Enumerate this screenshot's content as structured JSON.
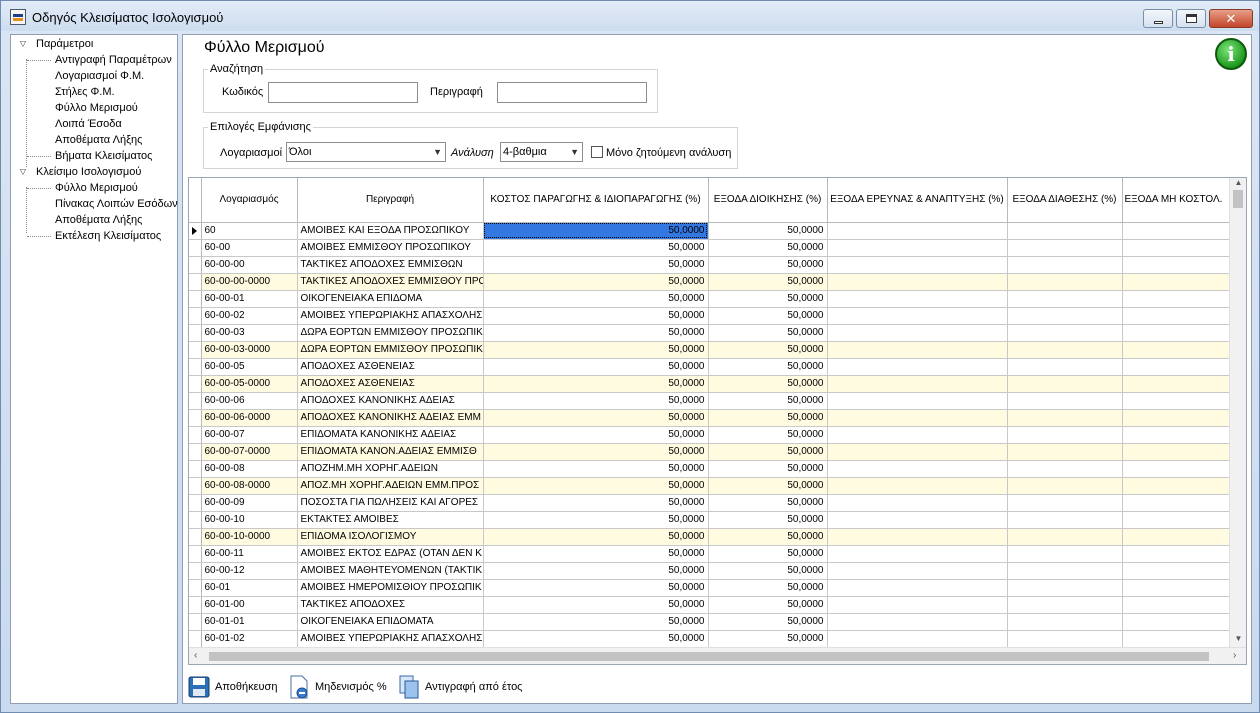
{
  "window": {
    "title": "Οδηγός Κλεισίματος Ισολογισμού"
  },
  "tree": {
    "groups": [
      {
        "label": "Παράμετροι",
        "items": [
          "Αντιγραφή Παραμέτρων",
          "Λογαριασμοί Φ.Μ.",
          "Στήλες Φ.Μ.",
          "Φύλλο Μερισμού",
          "Λοιπά Έσοδα",
          "Αποθέματα Λήξης",
          "Βήματα Κλεισίματος"
        ]
      },
      {
        "label": "Κλείσιμο Ισολογισμού",
        "items": [
          "Φύλλο Μερισμού",
          "Πίνακας Λοιπών Εσόδων",
          "Αποθέματα Λήξης",
          "Εκτέλεση Κλεισίματος"
        ]
      }
    ]
  },
  "page": {
    "title": "Φύλλο Μερισμού"
  },
  "search": {
    "legend": "Αναζήτηση",
    "code_label": "Κωδικός",
    "code_value": "",
    "desc_label": "Περιγραφή",
    "desc_value": ""
  },
  "display": {
    "legend": "Επιλογές Εμφάνισης",
    "accounts_label": "Λογαριασμοί",
    "accounts_value": "Όλοι",
    "analysis_label": "Ανάλυση",
    "analysis_value": "4-βαθμια",
    "only_label": "Μόνο ζητούμενη ανάλυση",
    "only_checked": false
  },
  "grid": {
    "columns": [
      "Λογαριασμός",
      "Περιγραφή",
      "ΚΟΣΤΟΣ ΠΑΡΑΓΩΓΗΣ & ΙΔΙΟΠΑΡΑΓΩΓΗΣ (%)",
      "ΕΞΟΔΑ ΔΙΟΙΚΗΣΗΣ (%)",
      "ΕΞΟΔΑ ΕΡΕΥΝΑΣ & ΑΝΑΠΤΥΞΗΣ (%)",
      "ΕΞΟΔΑ ΔΙΑΘΕΣΗΣ (%)",
      "ΕΞΟΔΑ ΜΗ ΚΟΣΤΟΛ."
    ],
    "rows": [
      [
        "60",
        "ΑΜΟΙΒΕΣ ΚΑΙ ΕΞΟΔΑ ΠΡΟΣΩΠΙΚΟΥ",
        "50,0000",
        "50,0000",
        "",
        "",
        ""
      ],
      [
        "60-00",
        "ΑΜΟΙΒΕΣ ΕΜΜΙΣΘΟΥ ΠΡΟΣΩΠΙΚΟΥ",
        "50,0000",
        "50,0000",
        "",
        "",
        ""
      ],
      [
        "60-00-00",
        "ΤΑΚΤΙΚΕΣ ΑΠΟΔΟΧΕΣ ΕΜΜΙΣΘΩΝ",
        "50,0000",
        "50,0000",
        "",
        "",
        ""
      ],
      [
        "60-00-00-0000",
        "ΤΑΚΤΙΚΕΣ ΑΠΟΔΟΧΕΣ ΕΜΜΙΣΘΟΥ ΠΡΟΣ",
        "50,0000",
        "50,0000",
        "",
        "",
        ""
      ],
      [
        "60-00-01",
        "ΟΙΚΟΓΕΝΕΙΑΚΑ ΕΠΙΔΟΜΑ",
        "50,0000",
        "50,0000",
        "",
        "",
        ""
      ],
      [
        "60-00-02",
        "ΑΜΟΙΒΕΣ ΥΠΕΡΩΡΙΑΚΗΣ ΑΠΑΣΧΟΛΗΣΙ",
        "50,0000",
        "50,0000",
        "",
        "",
        ""
      ],
      [
        "60-00-03",
        "ΔΩΡΑ ΕΟΡΤΩΝ ΕΜΜΙΣΘΟΥ ΠΡΟΣΩΠΙΚ",
        "50,0000",
        "50,0000",
        "",
        "",
        ""
      ],
      [
        "60-00-03-0000",
        "ΔΩΡΑ ΕΟΡΤΩΝ ΕΜΜΙΣΘΟΥ ΠΡΟΣΩΠΙΚ",
        "50,0000",
        "50,0000",
        "",
        "",
        ""
      ],
      [
        "60-00-05",
        "ΑΠΟΔΟΧΕΣ ΑΣΘΕΝΕΙΑΣ",
        "50,0000",
        "50,0000",
        "",
        "",
        ""
      ],
      [
        "60-00-05-0000",
        "ΑΠΟΔΟΧΕΣ ΑΣΘΕΝΕΙΑΣ",
        "50,0000",
        "50,0000",
        "",
        "",
        ""
      ],
      [
        "60-00-06",
        "ΑΠΟΔΟΧΕΣ ΚΑΝΟΝΙΚΗΣ ΑΔΕΙΑΣ",
        "50,0000",
        "50,0000",
        "",
        "",
        ""
      ],
      [
        "60-00-06-0000",
        "ΑΠΟΔΟΧΕΣ ΚΑΝΟΝΙΚΗΣ ΑΔΕΙΑΣ ΕΜΜ",
        "50,0000",
        "50,0000",
        "",
        "",
        ""
      ],
      [
        "60-00-07",
        "ΕΠΙΔΟΜΑΤΑ ΚΑΝΟΝΙΚΗΣ ΑΔΕΙΑΣ",
        "50,0000",
        "50,0000",
        "",
        "",
        ""
      ],
      [
        "60-00-07-0000",
        "ΕΠΙΔΟΜΑΤΑ ΚΑΝΟΝ.ΑΔΕΙΑΣ ΕΜΜΙΣΘ",
        "50,0000",
        "50,0000",
        "",
        "",
        ""
      ],
      [
        "60-00-08",
        "ΑΠΟΖΗΜ.ΜΗ ΧΟΡΗΓ.ΑΔΕΙΩΝ",
        "50,0000",
        "50,0000",
        "",
        "",
        ""
      ],
      [
        "60-00-08-0000",
        "ΑΠΟΖ.ΜΗ ΧΟΡΗΓ.ΑΔΕΙΩΝ ΕΜΜ.ΠΡΟΣ",
        "50,0000",
        "50,0000",
        "",
        "",
        ""
      ],
      [
        "60-00-09",
        "ΠΟΣΟΣΤΑ ΓΙΑ ΠΩΛΗΣΕΙΣ ΚΑΙ ΑΓΟΡΕΣ",
        "50,0000",
        "50,0000",
        "",
        "",
        ""
      ],
      [
        "60-00-10",
        "ΕΚΤΑΚΤΕΣ ΑΜΟΙΒΕΣ",
        "50,0000",
        "50,0000",
        "",
        "",
        ""
      ],
      [
        "60-00-10-0000",
        "ΕΠΙΔΟΜΑ ΙΣΟΛΟΓΙΣΜΟΥ",
        "50,0000",
        "50,0000",
        "",
        "",
        ""
      ],
      [
        "60-00-11",
        "ΑΜΟΙΒΕΣ ΕΚΤΟΣ ΕΔΡΑΣ (ΟΤΑΝ ΔΕΝ Κ",
        "50,0000",
        "50,0000",
        "",
        "",
        ""
      ],
      [
        "60-00-12",
        "ΑΜΟΙΒΕΣ ΜΑΘΗΤΕΥΟΜΕΝΩΝ (ΤΑΚΤΙΚ",
        "50,0000",
        "50,0000",
        "",
        "",
        ""
      ],
      [
        "60-01",
        "ΑΜΟΙΒΕΣ ΗΜΕΡΟΜΙΣΘΙΟΥ ΠΡΟΣΩΠΙΚ",
        "50,0000",
        "50,0000",
        "",
        "",
        ""
      ],
      [
        "60-01-00",
        "ΤΑΚΤΙΚΕΣ ΑΠΟΔΟΧΕΣ",
        "50,0000",
        "50,0000",
        "",
        "",
        ""
      ],
      [
        "60-01-01",
        "ΟΙΚΟΓΕΝΕΙΑΚΑ ΕΠΙΔΟΜΑΤΑ",
        "50,0000",
        "50,0000",
        "",
        "",
        ""
      ],
      [
        "60-01-02",
        "ΑΜΟΙΒΕΣ ΥΠΕΡΩΡΙΑΚΗΣ ΑΠΑΣΧΟΛΗΣΙ",
        "50,0000",
        "50,0000",
        "",
        "",
        ""
      ]
    ]
  },
  "toolbar": {
    "save_label": "Αποθήκευση",
    "zero_label": "Μηδενισμός %",
    "copy_label": "Αντιγραφή από έτος"
  },
  "colors": {
    "highlight_row": "#fffbe1",
    "selection": "#3377e0",
    "info_icon": "#1e9a1e"
  }
}
